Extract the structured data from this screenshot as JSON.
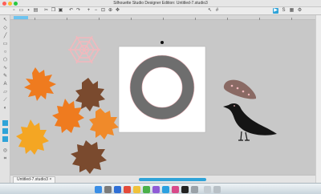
{
  "window": {
    "title": "Silhouette Studio Designer Edition: Untitled-7.studio3"
  },
  "document_tab": {
    "label": "Untitled-7.studio3"
  },
  "colors": {
    "accent": "#2fa3d8",
    "canvas": "#c8c8c8",
    "ring": "#6e6e6e",
    "page": "#ffffff",
    "leaf_orange": "#ef7b1f",
    "leaf_yellow": "#f4a623",
    "leaf_brown": "#7a4a2e",
    "crow": "#151515",
    "feather": "#8a6a64",
    "web": "#f2b8bd"
  },
  "icons": {
    "toolbar": [
      "new-document-icon",
      "open-folder-icon",
      "save-icon",
      "print-icon",
      "cut-icon",
      "copy-icon",
      "paste-icon",
      "undo-icon",
      "redo-icon",
      "zoom-in-icon",
      "zoom-out-icon",
      "fit-page-icon",
      "zoom-select-icon",
      "pan-icon",
      "move-icon",
      "grid-icon",
      "send-icon",
      "store-icon",
      "library-icon",
      "settings-icon"
    ],
    "sidebar": [
      "select-tool-icon",
      "edit-points-icon",
      "line-tool-icon",
      "rectangle-tool-icon",
      "ellipse-tool-icon",
      "polygon-tool-icon",
      "curve-tool-icon",
      "freehand-tool-icon",
      "text-tool-icon",
      "eraser-tool-icon",
      "knife-tool-icon",
      "fill-tool-icon",
      "line-style-icon",
      "layers-icon",
      "replicate-icon",
      "offset-icon",
      "trace-icon"
    ]
  }
}
